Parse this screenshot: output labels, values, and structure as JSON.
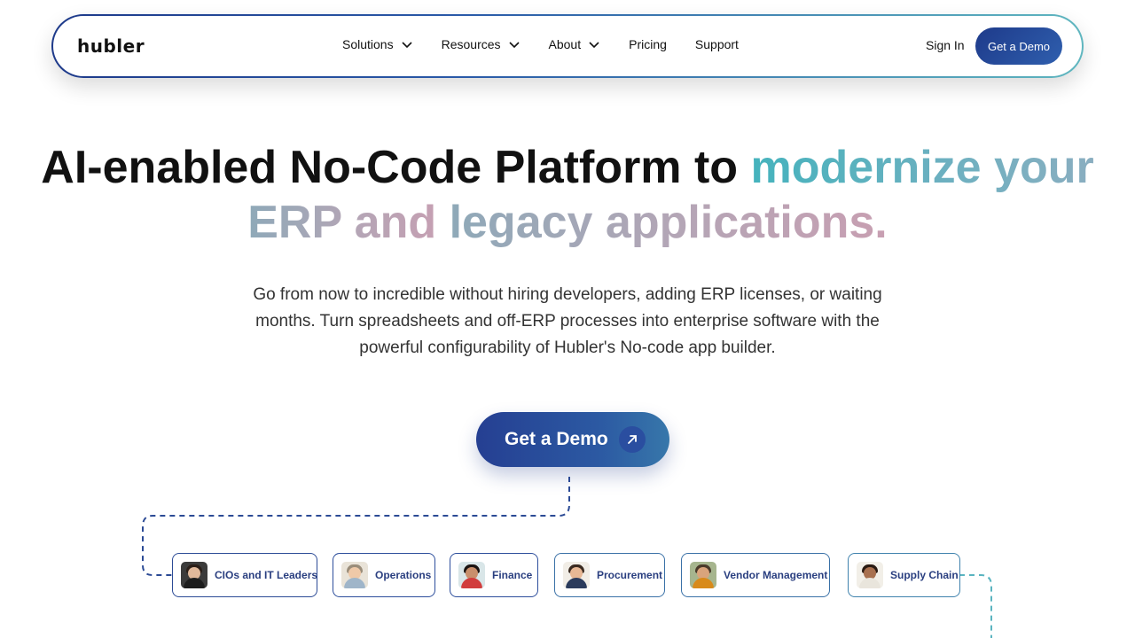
{
  "nav": {
    "logo": "hubler",
    "items": [
      {
        "label": "Solutions",
        "dropdown": true
      },
      {
        "label": "Resources",
        "dropdown": true
      },
      {
        "label": "About",
        "dropdown": true
      },
      {
        "label": "Pricing",
        "dropdown": false
      },
      {
        "label": "Support",
        "dropdown": false
      }
    ],
    "sign_in": "Sign In",
    "demo_button": "Get a Demo"
  },
  "hero": {
    "title_part1": "AI-enabled No-Code Platform to ",
    "title_highlight1": "modernize your",
    "title_highlight2a": "ERP and ",
    "title_highlight2b": "legacy applications.",
    "subtitle": "Go from now to incredible without hiring developers, adding ERP licenses, or waiting months. Turn spreadsheets and off-ERP processes into enterprise software with the powerful configurability of Hubler's No-code app builder.",
    "cta_label": "Get a Demo"
  },
  "roles": [
    {
      "label": "CIOs and IT Leaders",
      "avatar_bg": "#3b3b3b",
      "skin": "#e1b99b",
      "hair": "#2a1e18",
      "shirt": "#1d1d1d"
    },
    {
      "label": "Operations",
      "avatar_bg": "#e9e3d8",
      "skin": "#efc9a8",
      "hair": "#9a8d7a",
      "shirt": "#9fb5c9"
    },
    {
      "label": "Finance",
      "avatar_bg": "#d9e6e8",
      "skin": "#c98f6c",
      "hair": "#1b1411",
      "shirt": "#d13c3c"
    },
    {
      "label": "Procurement",
      "avatar_bg": "#f1ede6",
      "skin": "#e8b895",
      "hair": "#3a2a20",
      "shirt": "#2b3b5c"
    },
    {
      "label": "Vendor Management",
      "avatar_bg": "#a6b58e",
      "skin": "#d9a47c",
      "hair": "#4a3a2a",
      "shirt": "#d88a1a"
    },
    {
      "label": "Supply Chain",
      "avatar_bg": "#f2efe8",
      "skin": "#a8704f",
      "hair": "#2a1a12",
      "shirt": "#e9e5dc"
    }
  ]
}
